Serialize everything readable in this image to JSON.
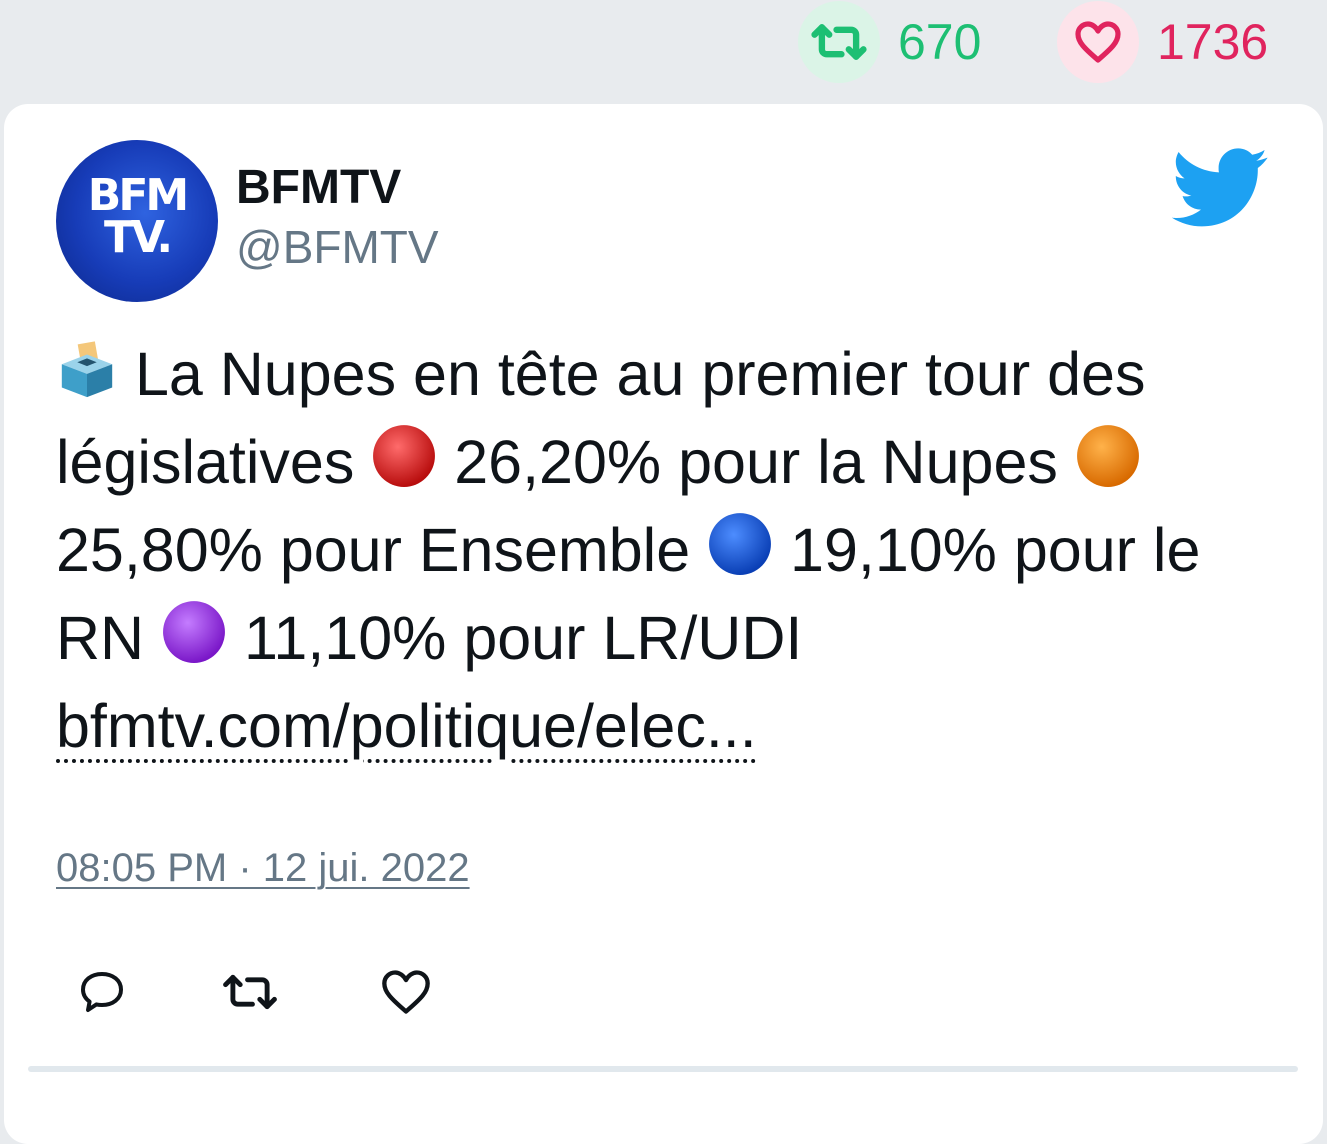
{
  "stats": {
    "retweets": "670",
    "likes": "1736"
  },
  "author": {
    "name": "BFMTV",
    "handle": "@BFMTV",
    "avatar_logo_line1": "BFM",
    "avatar_logo_line2": "TV."
  },
  "tweet": {
    "segments": {
      "s1": " La Nupes en tête au premier tour des législatives ",
      "s2": " 26,20% pour la Nupes ",
      "s3": " 25,80% pour Ensemble ",
      "s4": " 19,10% pour le RN ",
      "s5": " 11,10% pour LR/UDI "
    },
    "link": "bfmtv.com/politique/elec...",
    "timestamp": "08:05 PM · 12 jui. 2022"
  },
  "icons": {
    "ballot": "ballot-box-icon",
    "red": "red-circle-icon",
    "orange": "orange-circle-icon",
    "blue": "blue-circle-icon",
    "purple": "purple-circle-icon",
    "bird": "twitter-bird-icon"
  },
  "colors": {
    "retweet": "#1dbf73",
    "like": "#e0245e",
    "twitter_blue": "#1da1f2",
    "muted": "#657786",
    "text": "#0f1419"
  }
}
